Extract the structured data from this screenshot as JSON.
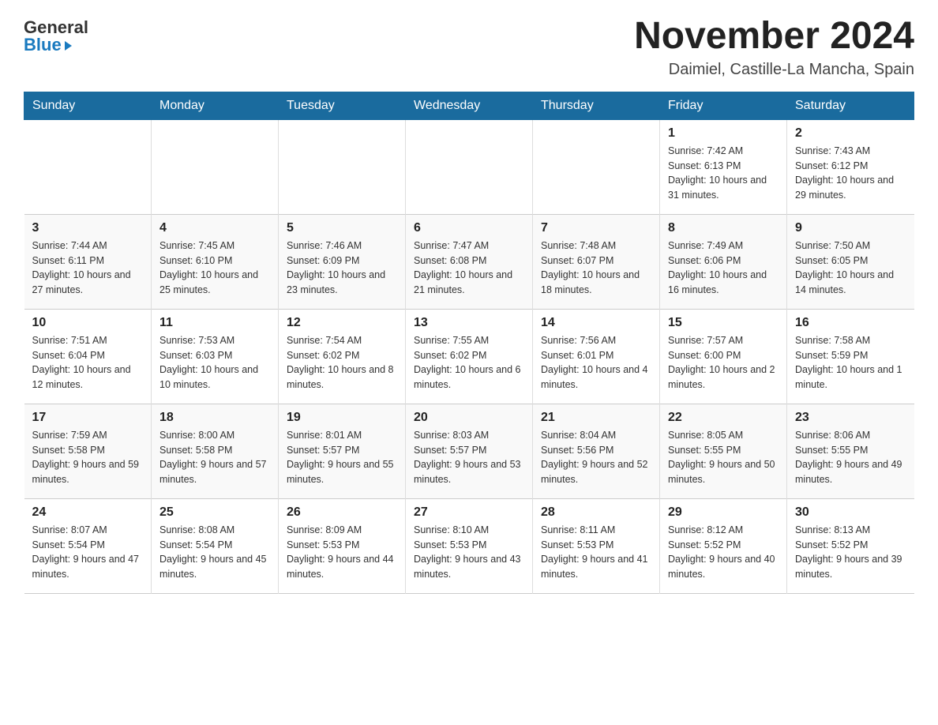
{
  "header": {
    "logo_general": "General",
    "logo_blue": "Blue",
    "title": "November 2024",
    "subtitle": "Daimiel, Castille-La Mancha, Spain"
  },
  "days_of_week": [
    "Sunday",
    "Monday",
    "Tuesday",
    "Wednesday",
    "Thursday",
    "Friday",
    "Saturday"
  ],
  "weeks": [
    [
      {
        "day": "",
        "info": ""
      },
      {
        "day": "",
        "info": ""
      },
      {
        "day": "",
        "info": ""
      },
      {
        "day": "",
        "info": ""
      },
      {
        "day": "",
        "info": ""
      },
      {
        "day": "1",
        "info": "Sunrise: 7:42 AM\nSunset: 6:13 PM\nDaylight: 10 hours and 31 minutes."
      },
      {
        "day": "2",
        "info": "Sunrise: 7:43 AM\nSunset: 6:12 PM\nDaylight: 10 hours and 29 minutes."
      }
    ],
    [
      {
        "day": "3",
        "info": "Sunrise: 7:44 AM\nSunset: 6:11 PM\nDaylight: 10 hours and 27 minutes."
      },
      {
        "day": "4",
        "info": "Sunrise: 7:45 AM\nSunset: 6:10 PM\nDaylight: 10 hours and 25 minutes."
      },
      {
        "day": "5",
        "info": "Sunrise: 7:46 AM\nSunset: 6:09 PM\nDaylight: 10 hours and 23 minutes."
      },
      {
        "day": "6",
        "info": "Sunrise: 7:47 AM\nSunset: 6:08 PM\nDaylight: 10 hours and 21 minutes."
      },
      {
        "day": "7",
        "info": "Sunrise: 7:48 AM\nSunset: 6:07 PM\nDaylight: 10 hours and 18 minutes."
      },
      {
        "day": "8",
        "info": "Sunrise: 7:49 AM\nSunset: 6:06 PM\nDaylight: 10 hours and 16 minutes."
      },
      {
        "day": "9",
        "info": "Sunrise: 7:50 AM\nSunset: 6:05 PM\nDaylight: 10 hours and 14 minutes."
      }
    ],
    [
      {
        "day": "10",
        "info": "Sunrise: 7:51 AM\nSunset: 6:04 PM\nDaylight: 10 hours and 12 minutes."
      },
      {
        "day": "11",
        "info": "Sunrise: 7:53 AM\nSunset: 6:03 PM\nDaylight: 10 hours and 10 minutes."
      },
      {
        "day": "12",
        "info": "Sunrise: 7:54 AM\nSunset: 6:02 PM\nDaylight: 10 hours and 8 minutes."
      },
      {
        "day": "13",
        "info": "Sunrise: 7:55 AM\nSunset: 6:02 PM\nDaylight: 10 hours and 6 minutes."
      },
      {
        "day": "14",
        "info": "Sunrise: 7:56 AM\nSunset: 6:01 PM\nDaylight: 10 hours and 4 minutes."
      },
      {
        "day": "15",
        "info": "Sunrise: 7:57 AM\nSunset: 6:00 PM\nDaylight: 10 hours and 2 minutes."
      },
      {
        "day": "16",
        "info": "Sunrise: 7:58 AM\nSunset: 5:59 PM\nDaylight: 10 hours and 1 minute."
      }
    ],
    [
      {
        "day": "17",
        "info": "Sunrise: 7:59 AM\nSunset: 5:58 PM\nDaylight: 9 hours and 59 minutes."
      },
      {
        "day": "18",
        "info": "Sunrise: 8:00 AM\nSunset: 5:58 PM\nDaylight: 9 hours and 57 minutes."
      },
      {
        "day": "19",
        "info": "Sunrise: 8:01 AM\nSunset: 5:57 PM\nDaylight: 9 hours and 55 minutes."
      },
      {
        "day": "20",
        "info": "Sunrise: 8:03 AM\nSunset: 5:57 PM\nDaylight: 9 hours and 53 minutes."
      },
      {
        "day": "21",
        "info": "Sunrise: 8:04 AM\nSunset: 5:56 PM\nDaylight: 9 hours and 52 minutes."
      },
      {
        "day": "22",
        "info": "Sunrise: 8:05 AM\nSunset: 5:55 PM\nDaylight: 9 hours and 50 minutes."
      },
      {
        "day": "23",
        "info": "Sunrise: 8:06 AM\nSunset: 5:55 PM\nDaylight: 9 hours and 49 minutes."
      }
    ],
    [
      {
        "day": "24",
        "info": "Sunrise: 8:07 AM\nSunset: 5:54 PM\nDaylight: 9 hours and 47 minutes."
      },
      {
        "day": "25",
        "info": "Sunrise: 8:08 AM\nSunset: 5:54 PM\nDaylight: 9 hours and 45 minutes."
      },
      {
        "day": "26",
        "info": "Sunrise: 8:09 AM\nSunset: 5:53 PM\nDaylight: 9 hours and 44 minutes."
      },
      {
        "day": "27",
        "info": "Sunrise: 8:10 AM\nSunset: 5:53 PM\nDaylight: 9 hours and 43 minutes."
      },
      {
        "day": "28",
        "info": "Sunrise: 8:11 AM\nSunset: 5:53 PM\nDaylight: 9 hours and 41 minutes."
      },
      {
        "day": "29",
        "info": "Sunrise: 8:12 AM\nSunset: 5:52 PM\nDaylight: 9 hours and 40 minutes."
      },
      {
        "day": "30",
        "info": "Sunrise: 8:13 AM\nSunset: 5:52 PM\nDaylight: 9 hours and 39 minutes."
      }
    ]
  ]
}
